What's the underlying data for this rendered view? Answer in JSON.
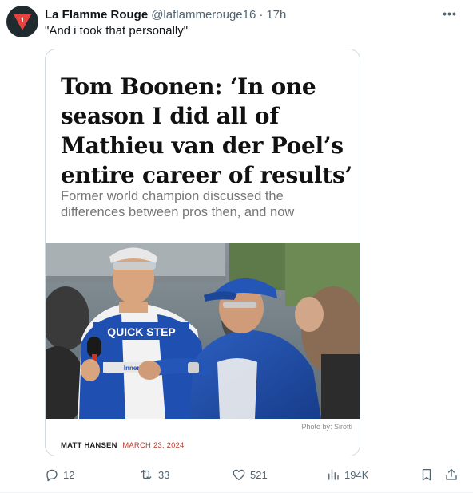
{
  "tweet": {
    "author_name": "La Flamme Rouge",
    "author_handle": "@laflammerouge16",
    "separator": "·",
    "time": "17h",
    "text": "\"And i took that personally\"",
    "more_label": "•••",
    "avatar_text": "1"
  },
  "card": {
    "headline": "Tom Boonen: ‘In one season I did all of Mathieu van der Poel’s entire career of results’",
    "subhead": "Former world champion discussed the differences between pros then, and now",
    "photo_credit": "Photo by: Sirotti",
    "byline_author": "MATT HANSEN",
    "byline_date": "MARCH 23, 2024",
    "jersey_text": "QUICK STEP",
    "jersey_text_2": "Innergetic"
  },
  "actions": {
    "replies": "12",
    "reposts": "33",
    "likes": "521",
    "views": "194K"
  },
  "colors": {
    "accent_red": "#c0392b",
    "avatar_bg": "#1f2b2f",
    "avatar_triangle": "#e8423f",
    "muted_text": "#536471"
  }
}
